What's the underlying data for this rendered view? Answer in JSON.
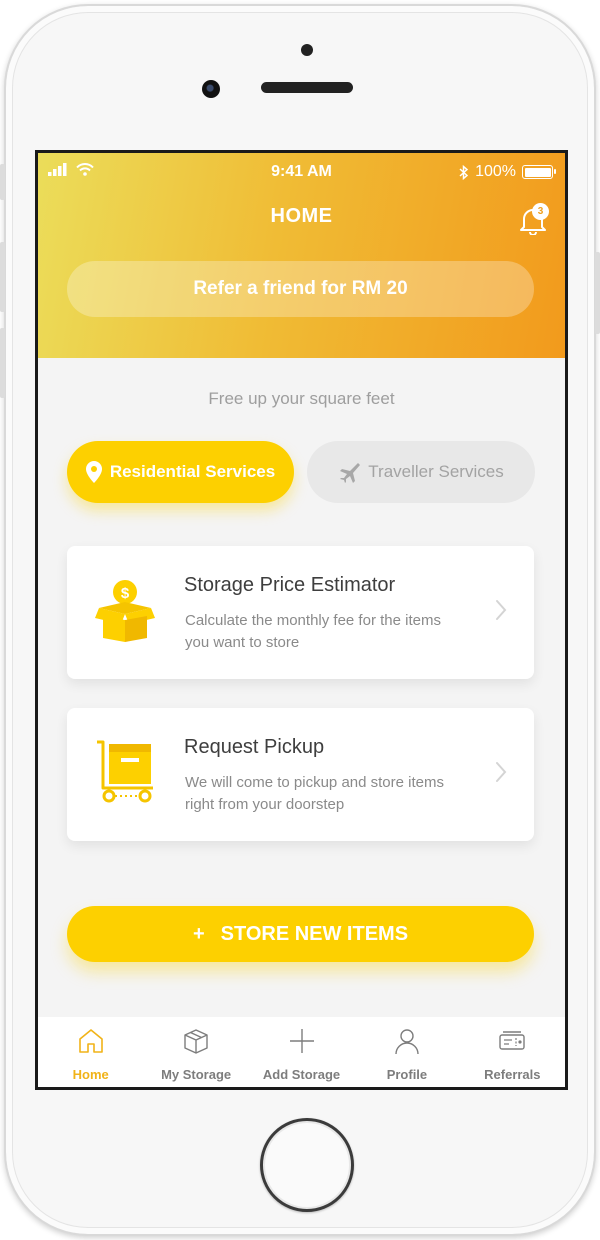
{
  "status_bar": {
    "time": "9:41 AM",
    "battery": "100%"
  },
  "header": {
    "title": "HOME",
    "notification_count": "3",
    "referral_label": "Refer a friend for RM 20"
  },
  "tagline": "Free up your square feet",
  "services": [
    {
      "label": "Residential Services",
      "icon": "location-pin-icon",
      "active": true
    },
    {
      "label": "Traveller Services",
      "icon": "airplane-icon",
      "active": false
    }
  ],
  "cards": [
    {
      "title": "Storage Price Estimator",
      "description": "Calculate the monthly fee for the items you want to store",
      "icon": "money-box-icon"
    },
    {
      "title": "Request Pickup",
      "description": "We will come to pickup and store items right from your doorstep",
      "icon": "trolley-box-icon"
    }
  ],
  "cta": {
    "symbol": "+",
    "label": "STORE NEW ITEMS"
  },
  "tabbar": [
    {
      "label": "Home",
      "icon": "home-icon",
      "active": true
    },
    {
      "label": "My Storage",
      "icon": "box-icon",
      "active": false
    },
    {
      "label": "Add Storage",
      "icon": "plus-icon",
      "active": false
    },
    {
      "label": "Profile",
      "icon": "person-icon",
      "active": false
    },
    {
      "label": "Referrals",
      "icon": "ticket-icon",
      "active": false
    }
  ],
  "colors": {
    "accent": "#fdd000",
    "header_start": "#ebdd5a",
    "header_end": "#f29a1c",
    "tab_active": "#f1b318"
  }
}
